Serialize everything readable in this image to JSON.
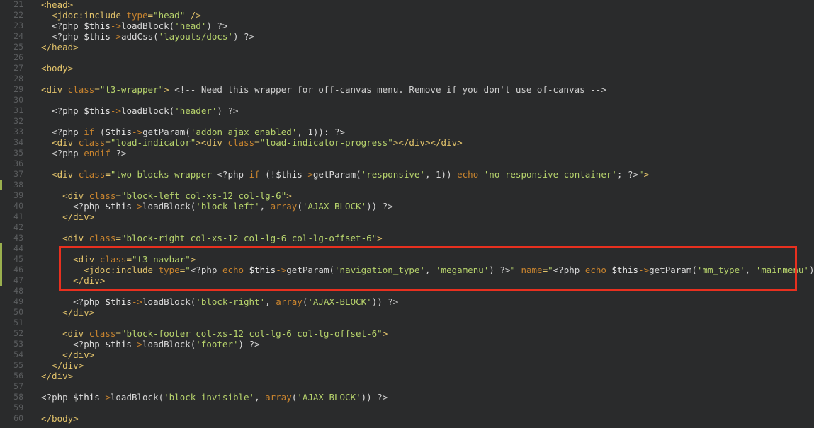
{
  "gutter_markers": [
    38,
    44,
    45,
    46,
    47
  ],
  "lines": [
    {
      "n": "21",
      "t": "<head>"
    },
    {
      "n": "22",
      "t": "  <jdoc:include type=\"head\" />"
    },
    {
      "n": "23",
      "t": "  <?php $this->loadBlock('head') ?>"
    },
    {
      "n": "24",
      "t": "  <?php $this->addCss('layouts/docs') ?>"
    },
    {
      "n": "25",
      "t": "</head>"
    },
    {
      "n": "26",
      "t": ""
    },
    {
      "n": "27",
      "t": "<body>"
    },
    {
      "n": "28",
      "t": ""
    },
    {
      "n": "29",
      "t": "<div class=\"t3-wrapper\"> <!-- Need this wrapper for off-canvas menu. Remove if you don't use of-canvas -->"
    },
    {
      "n": "30",
      "t": ""
    },
    {
      "n": "31",
      "t": "  <?php $this->loadBlock('header') ?>"
    },
    {
      "n": "32",
      "t": ""
    },
    {
      "n": "33",
      "t": "  <?php if ($this->getParam('addon_ajax_enabled', 1)): ?>"
    },
    {
      "n": "34",
      "t": "  <div class=\"load-indicator\"><div class=\"load-indicator-progress\"></div></div>"
    },
    {
      "n": "35",
      "t": "  <?php endif ?>"
    },
    {
      "n": "36",
      "t": ""
    },
    {
      "n": "37",
      "t": "  <div class=\"two-blocks-wrapper <?php if (!$this->getParam('responsive', 1)) echo 'no-responsive container'; ?>\">"
    },
    {
      "n": "38",
      "t": ""
    },
    {
      "n": "39",
      "t": "    <div class=\"block-left col-xs-12 col-lg-6\">"
    },
    {
      "n": "40",
      "t": "      <?php $this->loadBlock('block-left', array('AJAX-BLOCK')) ?>"
    },
    {
      "n": "41",
      "t": "    </div>"
    },
    {
      "n": "42",
      "t": ""
    },
    {
      "n": "43",
      "t": "    <div class=\"block-right col-xs-12 col-lg-6 col-lg-offset-6\">"
    },
    {
      "n": "44",
      "t": ""
    },
    {
      "n": "45",
      "t": "      <div class=\"t3-navbar\">"
    },
    {
      "n": "46",
      "t": "        <jdoc:include type=\"<?php echo $this->getParam('navigation_type', 'megamenu') ?>\" name=\"<?php echo $this->getParam('mm_type', 'mainmenu') ?>\" />"
    },
    {
      "n": "47",
      "t": "      </div>"
    },
    {
      "n": "48",
      "t": ""
    },
    {
      "n": "49",
      "t": "      <?php $this->loadBlock('block-right', array('AJAX-BLOCK')) ?>"
    },
    {
      "n": "50",
      "t": "    </div>"
    },
    {
      "n": "51",
      "t": ""
    },
    {
      "n": "52",
      "t": "    <div class=\"block-footer col-xs-12 col-lg-6 col-lg-offset-6\">"
    },
    {
      "n": "53",
      "t": "      <?php $this->loadBlock('footer') ?>"
    },
    {
      "n": "54",
      "t": "    </div>"
    },
    {
      "n": "55",
      "t": "  </div>"
    },
    {
      "n": "56",
      "t": "</div>"
    },
    {
      "n": "57",
      "t": ""
    },
    {
      "n": "58",
      "t": "<?php $this->loadBlock('block-invisible', array('AJAX-BLOCK')) ?>"
    },
    {
      "n": "59",
      "t": ""
    },
    {
      "n": "60",
      "t": "</body>"
    }
  ]
}
